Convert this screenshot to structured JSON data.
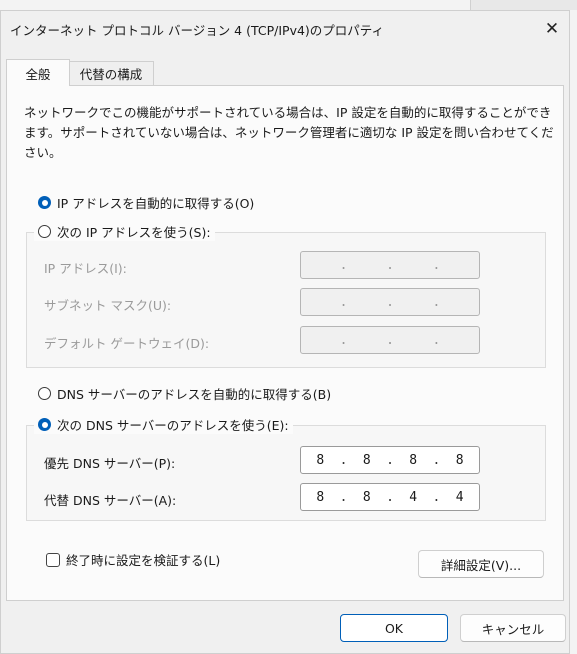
{
  "window": {
    "title": "インターネット プロトコル バージョン 4 (TCP/IPv4)のプロパティ",
    "close_glyph": "✕"
  },
  "tabs": [
    {
      "label": "全般",
      "selected": true
    },
    {
      "label": "代替の構成",
      "selected": false
    }
  ],
  "description": "ネットワークでこの機能がサポートされている場合は、IP 設定を自動的に取得することができます。サポートされていない場合は、ネットワーク管理者に適切な IP 設定を問い合わせてください。",
  "ip": {
    "auto_label": "IP アドレスを自動的に取得する(O)",
    "manual_label": "次の IP アドレスを使う(S):",
    "auto_selected": true,
    "fields": [
      {
        "label": "IP アドレス(I):",
        "octets": [
          "",
          "",
          "",
          ""
        ]
      },
      {
        "label": "サブネット マスク(U):",
        "octets": [
          "",
          "",
          "",
          ""
        ]
      },
      {
        "label": "デフォルト ゲートウェイ(D):",
        "octets": [
          "",
          "",
          "",
          ""
        ]
      }
    ],
    "separator": "."
  },
  "dns": {
    "auto_label": "DNS サーバーのアドレスを自動的に取得する(B)",
    "manual_label": "次の DNS サーバーのアドレスを使う(E):",
    "manual_selected": true,
    "fields": [
      {
        "label": "優先 DNS サーバー(P):",
        "octets": [
          "8",
          "8",
          "8",
          "8"
        ]
      },
      {
        "label": "代替 DNS サーバー(A):",
        "octets": [
          "8",
          "8",
          "4",
          "4"
        ]
      }
    ]
  },
  "validate": {
    "label": "終了時に設定を検証する(L)",
    "checked": false
  },
  "buttons": {
    "advanced": "詳細設定(V)...",
    "ok": "OK",
    "cancel": "キャンセル"
  },
  "colors": {
    "accent": "#005fb8"
  }
}
